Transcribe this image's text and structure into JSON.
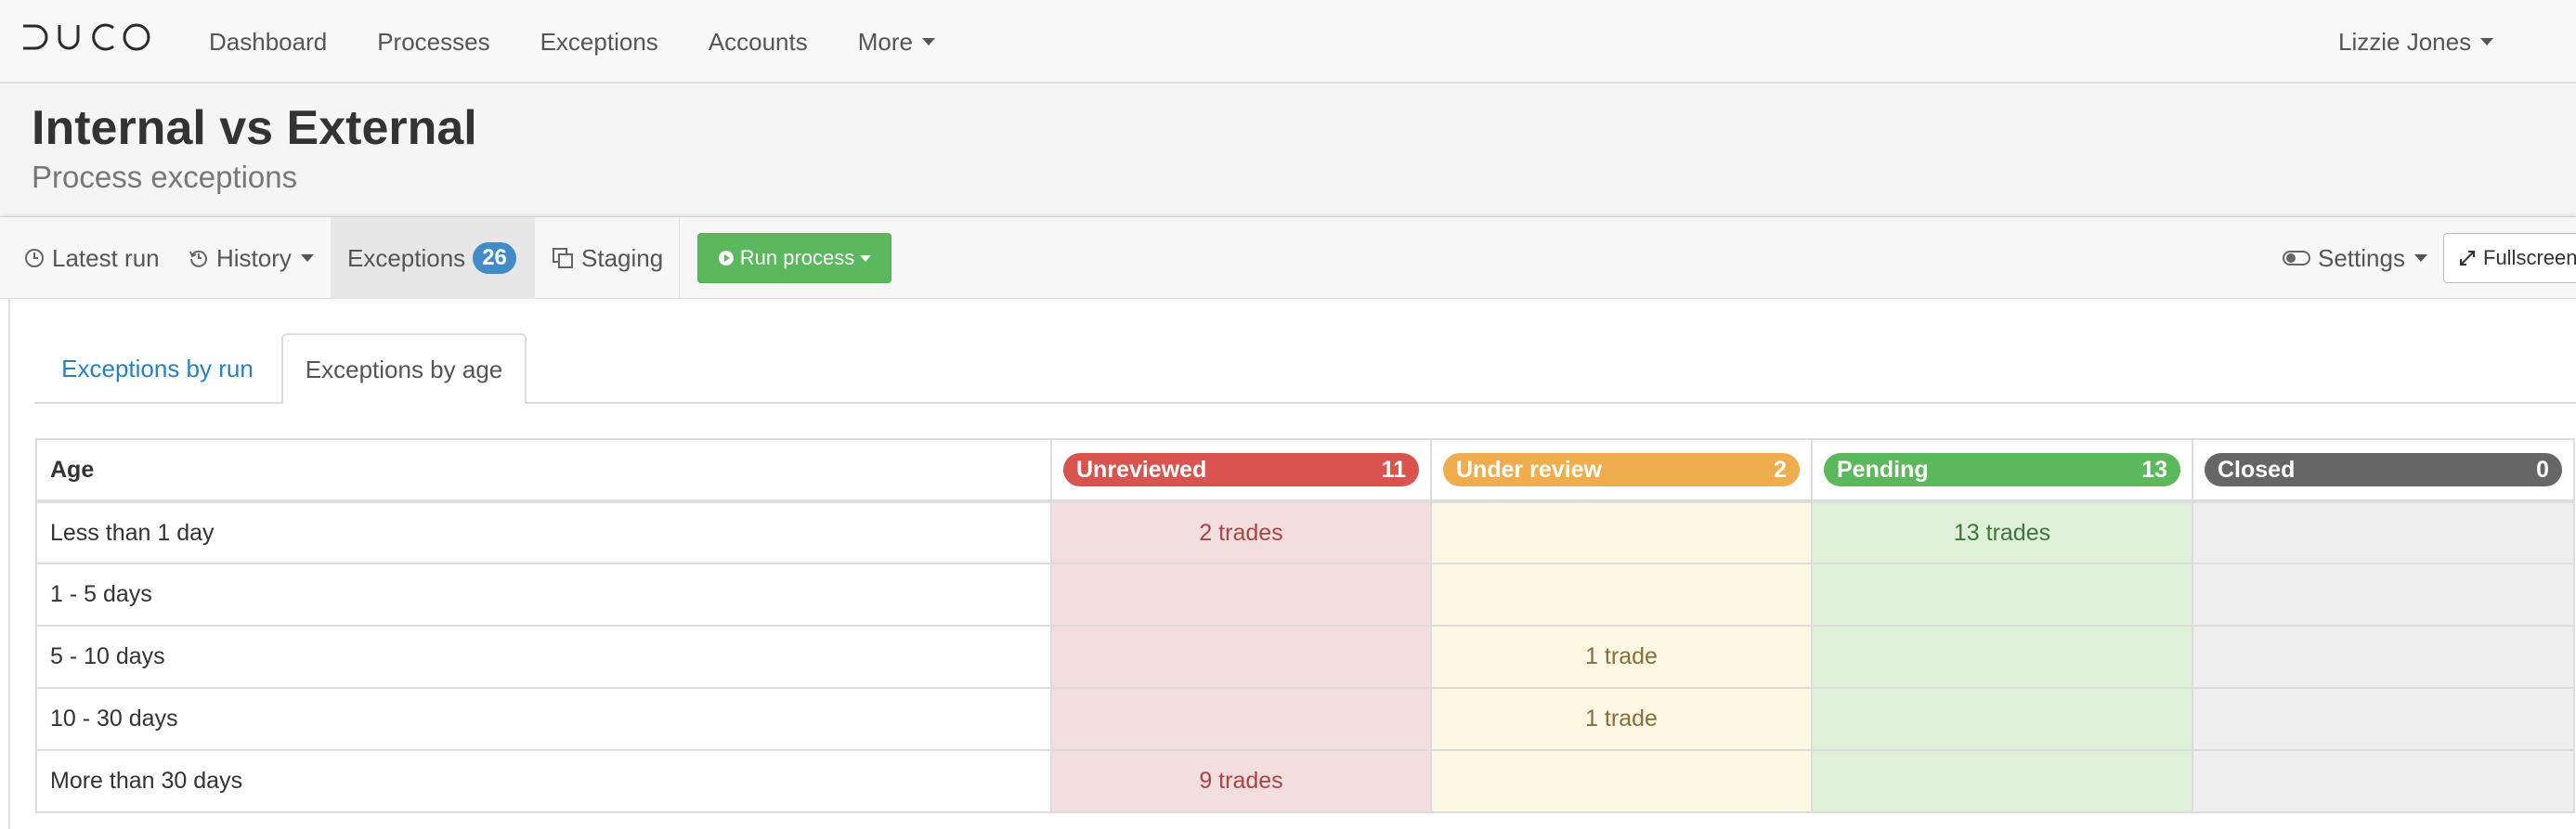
{
  "navbar": {
    "logo": "DUCO",
    "links": [
      {
        "label": "Dashboard"
      },
      {
        "label": "Processes"
      },
      {
        "label": "Exceptions"
      },
      {
        "label": "Accounts"
      },
      {
        "label": "More"
      }
    ],
    "user": "Lizzie Jones"
  },
  "header": {
    "title": "Internal vs External",
    "subtitle": "Process exceptions"
  },
  "toolbar": {
    "latest_run": "Latest run",
    "history": "History",
    "exceptions": "Exceptions",
    "exceptions_count": "26",
    "staging": "Staging",
    "run_process": "Run process",
    "settings": "Settings",
    "fullscreen": "Fullscreen"
  },
  "tabs": [
    {
      "label": "Exceptions by run",
      "active": false
    },
    {
      "label": "Exceptions by age",
      "active": true
    }
  ],
  "table": {
    "age_header": "Age",
    "statuses": [
      {
        "label": "Unreviewed",
        "count": "11",
        "color": "#d9534f"
      },
      {
        "label": "Under review",
        "count": "2",
        "color": "#f0ad4e"
      },
      {
        "label": "Pending",
        "count": "13",
        "color": "#5cb85c"
      },
      {
        "label": "Closed",
        "count": "0",
        "color": "#666666"
      }
    ],
    "rows": [
      {
        "age": "Less than 1 day",
        "cells": [
          "2 trades",
          "",
          "13 trades",
          ""
        ]
      },
      {
        "age": "1 - 5 days",
        "cells": [
          "",
          "",
          "",
          ""
        ]
      },
      {
        "age": "5 - 10 days",
        "cells": [
          "",
          "1 trade",
          "",
          ""
        ]
      },
      {
        "age": "10 - 30 days",
        "cells": [
          "",
          "1 trade",
          "",
          ""
        ]
      },
      {
        "age": "More than 30 days",
        "cells": [
          "9 trades",
          "",
          "",
          ""
        ]
      }
    ]
  }
}
